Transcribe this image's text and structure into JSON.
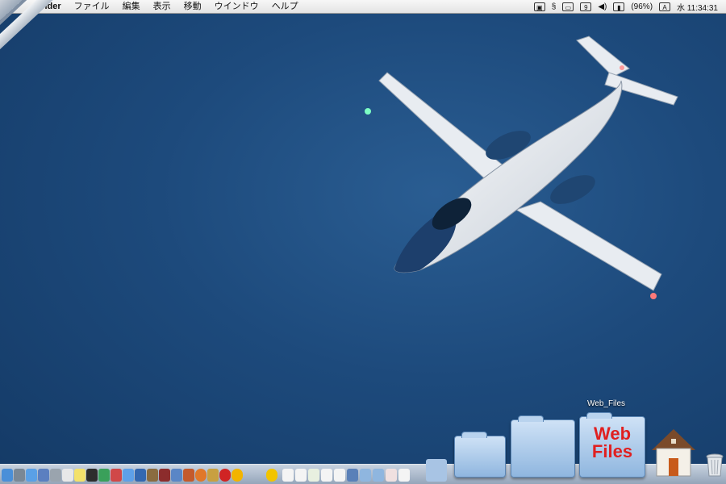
{
  "menubar": {
    "app": "Finder",
    "items": [
      "ファイル",
      "編集",
      "表示",
      "移動",
      "ウインドウ",
      "ヘルプ"
    ],
    "battery": "(96%)",
    "input_mode": "A",
    "clock": "水 11:34:31"
  },
  "desktop": {
    "wallpaper_colors": [
      "#2a5d92",
      "#143a66"
    ]
  },
  "dock": {
    "stack_label": "Web_Files",
    "webfiles_icon_text": [
      "Web",
      "Files"
    ],
    "items_left": [
      "finder",
      "system-preferences",
      "mail",
      "itunes",
      "calculator",
      "stickies",
      "terminal",
      "preview",
      "ical",
      "safari",
      "address-book",
      "app1",
      "app2",
      "firefox",
      "app3",
      "opera",
      "app4"
    ],
    "items_right": [
      "app5",
      "doc1",
      "doc2",
      "doc3",
      "doc4",
      "doc5",
      "doc6",
      "doc7",
      "doc8",
      "doc9",
      "folder1",
      "folder2",
      "doc10",
      "doc11"
    ],
    "colors": {
      "accent": "#3b7fd6",
      "red": "#e02020"
    }
  }
}
